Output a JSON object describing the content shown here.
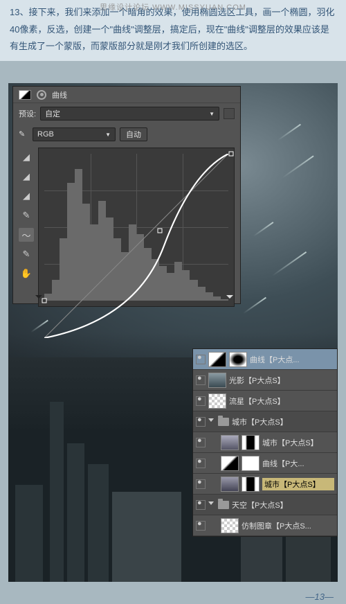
{
  "watermark": "思缘设计论坛  WWW.MISSYUAN.COM",
  "intro": "13、接下来，我们来添加一个暗角的效果，使用椭圆选区工具，画一个椭圆，羽化40像素，反选，创建一个\"曲线\"调整层，搞定后，现在\"曲线\"调整层的效果应该是有生成了一个蒙版，而蒙版部分就是刚才我们所创建的选区。",
  "curves": {
    "title": "曲线",
    "preset_label": "预设:",
    "preset_value": "自定",
    "channel_value": "RGB",
    "auto_btn": "自动"
  },
  "layers": [
    {
      "type": "adj",
      "name": "曲线【P大点...",
      "selected": true,
      "thumb1": "adj",
      "thumb2": "mask-vignette"
    },
    {
      "type": "layer",
      "name": "光影【P大点S】",
      "thumb": "grad-sky"
    },
    {
      "type": "layer",
      "name": "流星【P大点S】",
      "thumb": "checker"
    },
    {
      "type": "group",
      "name": "城市【P大点S】"
    },
    {
      "type": "layer",
      "name": "城市【P大点S】",
      "indent": 1,
      "thumb": "city1",
      "thumb2": "mask-city"
    },
    {
      "type": "layer",
      "name": "曲线【P大...",
      "indent": 1,
      "thumb": "adj",
      "thumb2": "mask-white"
    },
    {
      "type": "layer",
      "name": "城市【P大点S】",
      "indent": 1,
      "thumb": "city2",
      "thumb2": "mask-city",
      "hl": true
    },
    {
      "type": "group",
      "name": "天空【P大点S】"
    },
    {
      "type": "layer",
      "name": "仿制图章【P大点S...",
      "indent": 1,
      "thumb": "checker"
    }
  ],
  "page_num": "—13—"
}
